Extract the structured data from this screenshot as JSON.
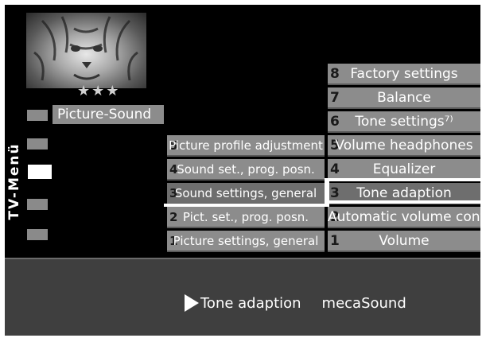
{
  "menu_title": "TV-Menü",
  "rating_stars": "★★★",
  "submenu_label": "Picture-Sound",
  "middle_menu": [
    {
      "num": "5",
      "label": "Picture profile adjustment"
    },
    {
      "num": "4",
      "label": "Sound set., prog. posn."
    },
    {
      "num": "3",
      "label": "Sound settings, general"
    },
    {
      "num": "2",
      "label": "Pict. set., prog. posn."
    },
    {
      "num": "1",
      "label": "Picture settings, general"
    }
  ],
  "right_menu": [
    {
      "num": "8",
      "label": "Factory settings"
    },
    {
      "num": "7",
      "label": "Balance"
    },
    {
      "num": "6",
      "label": "Tone settings⁷⁾"
    },
    {
      "num": "5",
      "label": "Volume headphones"
    },
    {
      "num": "4",
      "label": "Equalizer"
    },
    {
      "num": "3",
      "label": "Tone adaption"
    },
    {
      "num": "2",
      "label": "Automatic volume control"
    },
    {
      "num": "1",
      "label": "Volume"
    }
  ],
  "status": {
    "item": "Tone adaption",
    "value": "mecaSound"
  }
}
